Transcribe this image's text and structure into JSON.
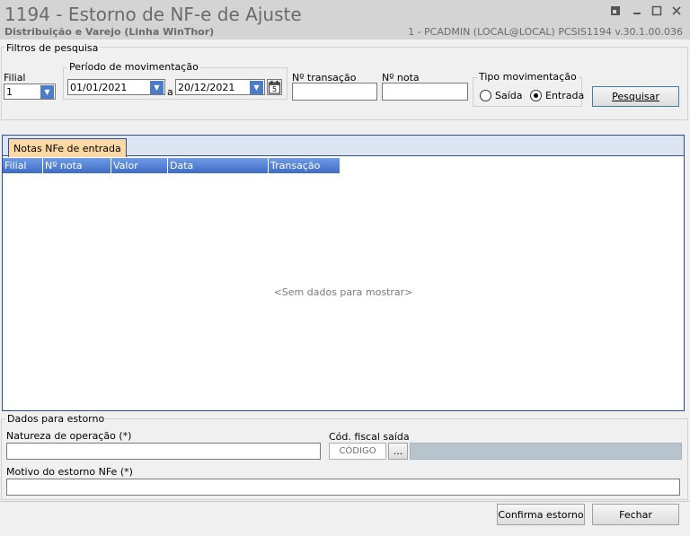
{
  "window": {
    "title": "1194 - Estorno de NF-e de Ajuste",
    "subtitle": "Distribuição e Varejo (Linha WinThor)",
    "user_info": "1 - PCADMIN (LOCAL@LOCAL)   PCSIS1194  v.30.1.00.036"
  },
  "filters": {
    "group_title": "Filtros de pesquisa",
    "filial_label": "Filial",
    "filial_value": "1",
    "periodo_title": "Período de movimentação",
    "date_from": "01/01/2021",
    "date_sep": "a",
    "date_to": "20/12/2021",
    "calendar_day": "5",
    "transacao_label": "Nº transação",
    "transacao_value": "",
    "nota_label": "Nº nota",
    "nota_value": "",
    "tipo_title": "Tipo movimentação",
    "saida_label": "Saída",
    "entrada_label": "Entrada",
    "tipo_selected": "Entrada",
    "search_button": "Pesquisar"
  },
  "grid": {
    "tab_label": "Notas NFe de entrada",
    "columns": [
      "Filial",
      "Nº nota",
      "Valor",
      "Data",
      "Transação"
    ],
    "rows": [],
    "empty_text": "<Sem dados para mostrar>"
  },
  "estorno": {
    "group_title": "Dados para estorno",
    "natureza_label": "Natureza de operação (*)",
    "natureza_value": "",
    "cfop_label": "Cód. fiscal saída",
    "cfop_placeholder": "CÓDIGO",
    "cfop_lookup": "...",
    "motivo_label": "Motivo do estorno NFe (*)",
    "motivo_value": ""
  },
  "footer": {
    "confirm_button": "Confirma estorno",
    "close_button": "Fechar"
  }
}
